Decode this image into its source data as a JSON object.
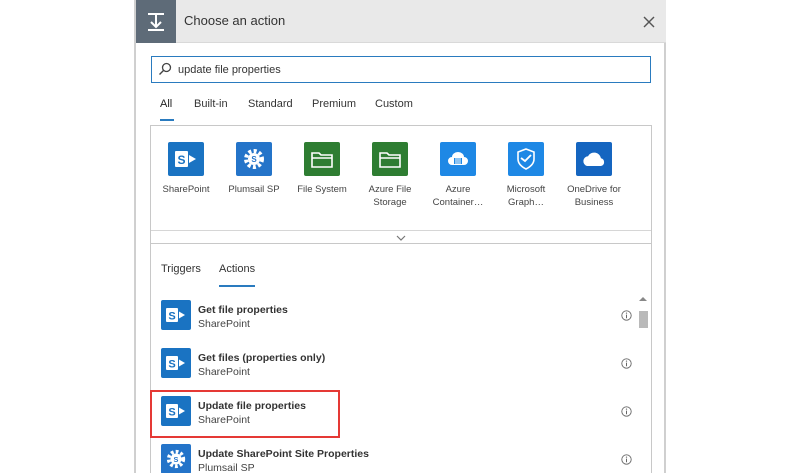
{
  "dialog": {
    "title": "Choose an action"
  },
  "search": {
    "value": "update file properties"
  },
  "tabs": [
    {
      "label": "All",
      "active": true
    },
    {
      "label": "Built-in"
    },
    {
      "label": "Standard"
    },
    {
      "label": "Premium"
    },
    {
      "label": "Custom"
    }
  ],
  "connectors": [
    {
      "label": "SharePoint",
      "icon": "sharepoint-icon",
      "color": "#1a73c2"
    },
    {
      "label": "Plumsail SP",
      "icon": "gear-icon",
      "color": "#2474c9"
    },
    {
      "label": "File System",
      "icon": "folder-icon",
      "color": "#2e7d32"
    },
    {
      "label": "Azure File Storage",
      "icon": "folder-icon",
      "color": "#2e7d32"
    },
    {
      "label": "Azure Container…",
      "icon": "container-icon",
      "color": "#1e88e5"
    },
    {
      "label": "Microsoft Graph…",
      "icon": "graph-icon",
      "color": "#1e88e5"
    },
    {
      "label": "OneDrive for Business",
      "icon": "cloud-icon",
      "color": "#1565c0"
    }
  ],
  "subtabs": [
    {
      "label": "Triggers"
    },
    {
      "label": "Actions",
      "active": true
    }
  ],
  "actions": [
    {
      "title": "Get file properties",
      "subtitle": "SharePoint",
      "icon": "sharepoint-icon",
      "color": "#1a73c2"
    },
    {
      "title": "Get files (properties only)",
      "subtitle": "SharePoint",
      "icon": "sharepoint-icon",
      "color": "#1a73c2"
    },
    {
      "title": "Update file properties",
      "subtitle": "SharePoint",
      "icon": "sharepoint-icon",
      "color": "#1a73c2",
      "highlighted": true
    },
    {
      "title": "Update SharePoint Site Properties",
      "subtitle": "Plumsail SP",
      "icon": "gear-icon",
      "color": "#2474c9"
    }
  ],
  "colors": {
    "accent": "#2a7bbf",
    "highlight": "#e53935",
    "header_bg": "#e9e9e9",
    "header_icon_bg": "#5e6b78"
  }
}
